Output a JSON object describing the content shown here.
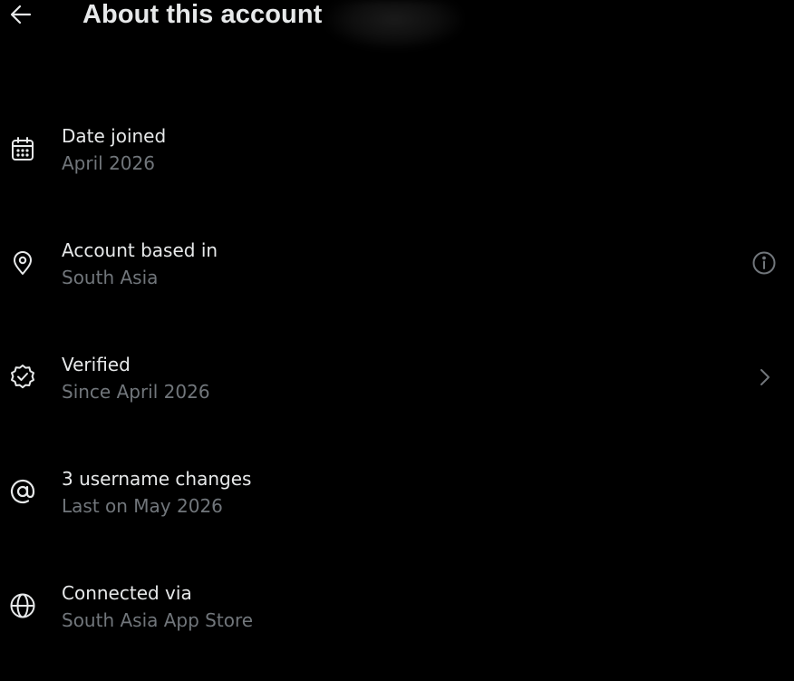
{
  "header": {
    "title": "About this account",
    "back_icon": "arrow-left-icon"
  },
  "colors": {
    "background": "#000000",
    "primary_text": "#e7e9ea",
    "secondary_text": "#71767b"
  },
  "rows": [
    {
      "icon": "calendar-icon",
      "primary": "Date joined",
      "secondary": "April 2026"
    },
    {
      "icon": "location-pin-icon",
      "primary": "Account based in",
      "secondary": "South Asia",
      "trailing_icon": "info-icon"
    },
    {
      "icon": "verified-badge-icon",
      "primary": "Verified",
      "secondary": "Since April 2026",
      "trailing_icon": "chevron-right-icon"
    },
    {
      "icon": "at-sign-icon",
      "primary": "3 username changes",
      "secondary": "Last on May 2026"
    },
    {
      "icon": "globe-icon",
      "primary": "Connected via",
      "secondary": "South Asia App Store"
    }
  ]
}
